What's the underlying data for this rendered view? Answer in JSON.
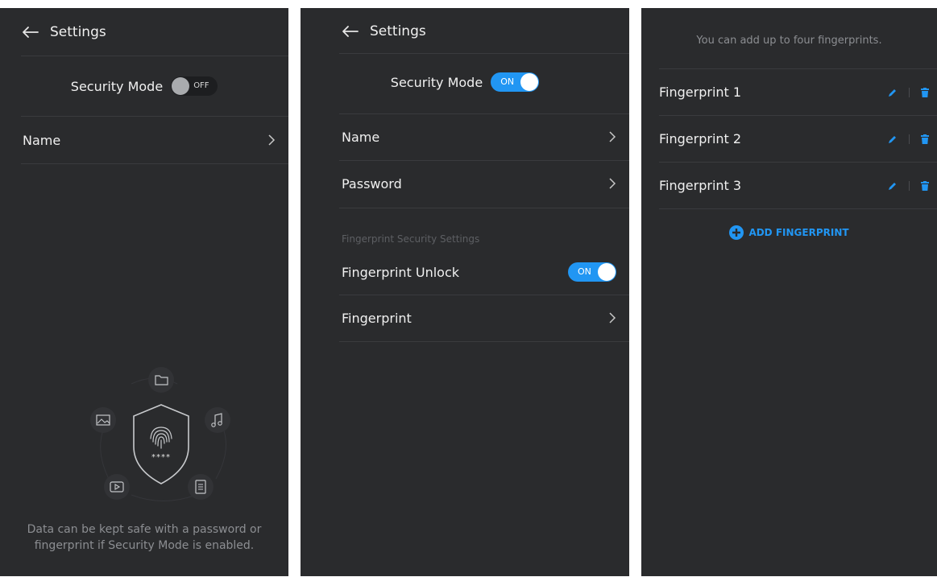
{
  "colors": {
    "panel_bg": "#2a2b2d",
    "accent": "#2196f3",
    "divider": "#3a3b3e",
    "muted_text": "#8c8e92"
  },
  "panel1": {
    "header_title": "Settings",
    "security_mode_label": "Security Mode",
    "security_mode_state": "OFF",
    "items": [
      {
        "label": "Name"
      }
    ],
    "illustration_text": "****",
    "footer_text": "Data can be kept safe with a password or fingerprint if Security Mode is enabled."
  },
  "panel2": {
    "header_title": "Settings",
    "security_mode_label": "Security Mode",
    "security_mode_state": "ON",
    "items": [
      {
        "label": "Name"
      },
      {
        "label": "Password"
      }
    ],
    "section_title": "Fingerprint Security Settings",
    "fingerprint_unlock_label": "Fingerprint Unlock",
    "fingerprint_unlock_state": "ON",
    "fingerprint_label": "Fingerprint"
  },
  "panel3": {
    "info_text": "You can add up to four fingerprints.",
    "fingerprints": [
      {
        "name": "Fingerprint 1"
      },
      {
        "name": "Fingerprint 2"
      },
      {
        "name": "Fingerprint 3"
      }
    ],
    "add_label": "ADD FINGERPRINT"
  }
}
